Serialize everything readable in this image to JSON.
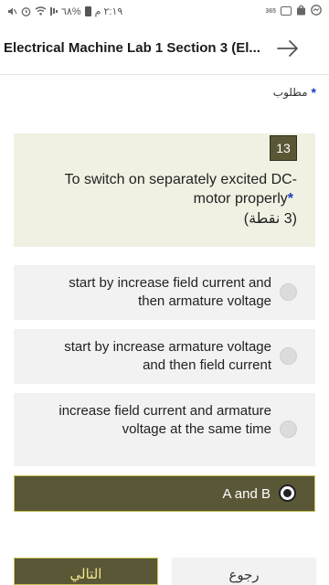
{
  "status_bar": {
    "time": "٢:١٩ م",
    "battery": "%٦٨",
    "icons": [
      "battery-icon",
      "signal-icon",
      "wifi-icon",
      "alarm-icon",
      "mute-icon",
      "hd-icon",
      "gallery-icon",
      "shopping-icon",
      "messenger-icon"
    ]
  },
  "header": {
    "title": "Electrical Machine Lab 1 Section 3  (El...",
    "next_icon": "arrow-right-icon"
  },
  "required_note": {
    "star": "*",
    "text": "مطلوب"
  },
  "question": {
    "number": "13",
    "text": "To switch on separately excited DC-motor properly",
    "star": "*",
    "points": "(3 نقطة)"
  },
  "options": [
    {
      "label": "start by increase field current and then armature voltage",
      "selected": false
    },
    {
      "label": "start by increase armature voltage and then field current",
      "selected": false
    },
    {
      "label": "increase field current and armature voltage at the same time",
      "selected": false
    },
    {
      "label": "A and B",
      "selected": true
    }
  ],
  "nav": {
    "next_label": "التالي",
    "back_label": "رجوع"
  },
  "colors": {
    "accent": "#5a5737",
    "card_bg": "#f1f1e3",
    "option_bg": "#f2f2f2",
    "required_star": "#1a3bbf"
  }
}
